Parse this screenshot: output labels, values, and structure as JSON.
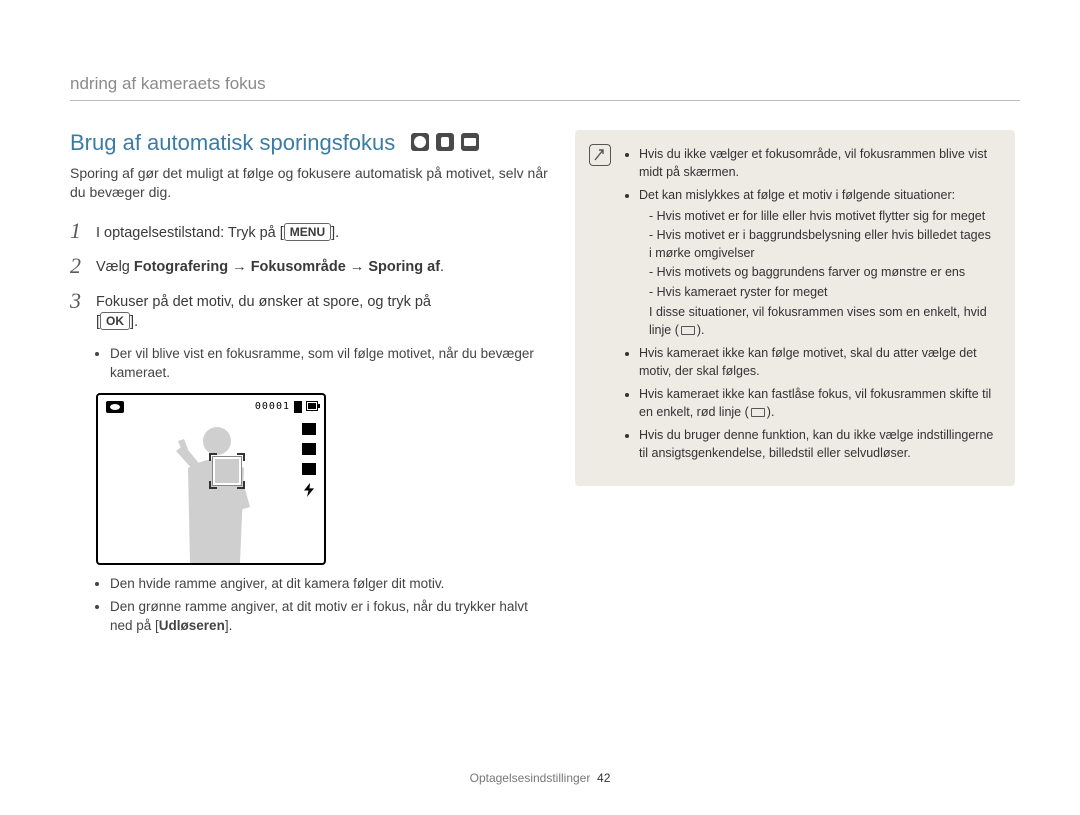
{
  "header": "ndring af kameraets fokus",
  "section_title": "Brug af automatisk sporingsfokus",
  "intro": "Sporing af gør det muligt at følge og fokusere automatisk på motivet, selv når du bevæger dig.",
  "steps": {
    "s1": {
      "num": "1",
      "pre": "I optagelsestilstand: Tryk på [",
      "btn": "MENU",
      "post": "]."
    },
    "s2": {
      "num": "2",
      "pre": "Vælg ",
      "bold": "Fotografering → Fokusområde → Sporing af",
      "post": "."
    },
    "s3": {
      "num": "3",
      "line": "Fokuser på det motiv, du ønsker at spore, og tryk på",
      "btn": "OK",
      "post2": "."
    }
  },
  "bullets_a": [
    "Der vil blive vist en fokusramme, som vil følge motivet, når du bevæger kameraet."
  ],
  "hud_counter": "00001",
  "bullets_b": [
    "Den hvide ramme angiver, at dit kamera følger dit motiv.",
    "Den grønne ramme angiver, at dit motiv er i fokus, når du trykker halvt ned på [Udløseren]."
  ],
  "shutter_word": "Udløseren",
  "note": {
    "items": [
      "Hvis du ikke vælger et fokusområde, vil fokusrammen blive vist midt på skærmen.",
      "Det kan mislykkes at følge et motiv i følgende situationer:"
    ],
    "sub": [
      "Hvis motivet er for lille eller hvis motivet flytter sig for meget",
      "Hvis motivet er i baggrundsbelysning eller hvis billedet tages i mørke omgivelser",
      "Hvis motivets og baggrundens farver og mønstre er ens",
      "Hvis kameraet ryster for meget"
    ],
    "subnote_pre": "I disse situationer, vil fokusrammen vises som en enkelt, hvid linje (",
    "subnote_post": ").",
    "items2": [
      "Hvis kameraet ikke kan følge motivet, skal du atter vælge det motiv, der skal følges."
    ],
    "item3_pre": "Hvis kameraet ikke kan fastlåse fokus, vil fokusrammen skifte til en enkelt, rød linje (",
    "item3_post": ").",
    "items4": [
      "Hvis du bruger denne funktion, kan du ikke vælge indstillingerne til ansigtsgenkendelse, billedstil eller selvudløser."
    ]
  },
  "footer": {
    "section": "Optagelsesindstillinger",
    "page": "42"
  }
}
